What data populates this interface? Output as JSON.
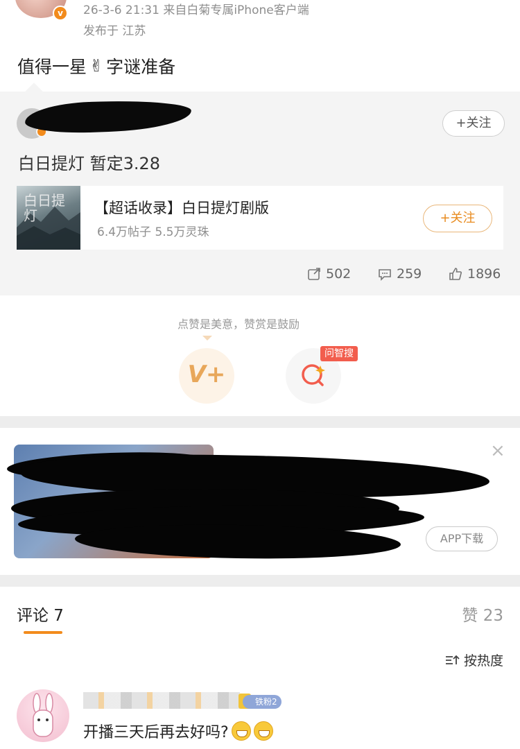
{
  "post": {
    "meta": "26-3-6 21:31 来自白菊专属iPhone客户端",
    "location": "发布于 江苏",
    "text_before": "值得一星",
    "emoji": "✌",
    "text_after": "字谜准备"
  },
  "repost": {
    "follow_label": "+关注",
    "text": "白日提灯 暂定3.28",
    "topic": {
      "thumb_text": "白日提灯",
      "title": "【超话收录】白日提灯剧版",
      "stats": "6.4万帖子 5.5万灵珠",
      "follow_label": "+关注"
    },
    "actions": {
      "reposts": "502",
      "comments": "259",
      "likes": "1896"
    }
  },
  "reward": {
    "caption": "点赞是美意，赞赏是鼓励",
    "search_tag": "问智搜"
  },
  "ad": {
    "app_button": "APP下载",
    "close": "×"
  },
  "comments": {
    "header": "评论 7",
    "likes_total": "赞 23",
    "sort_label": "按热度",
    "items": [
      {
        "fan_badge": "铁粉2",
        "text": "开播三天后再去好吗?"
      }
    ]
  },
  "colors": {
    "accent": "#f28b1c",
    "follow_orange": "#e88b1f",
    "tag_red": "#f25d4d"
  }
}
